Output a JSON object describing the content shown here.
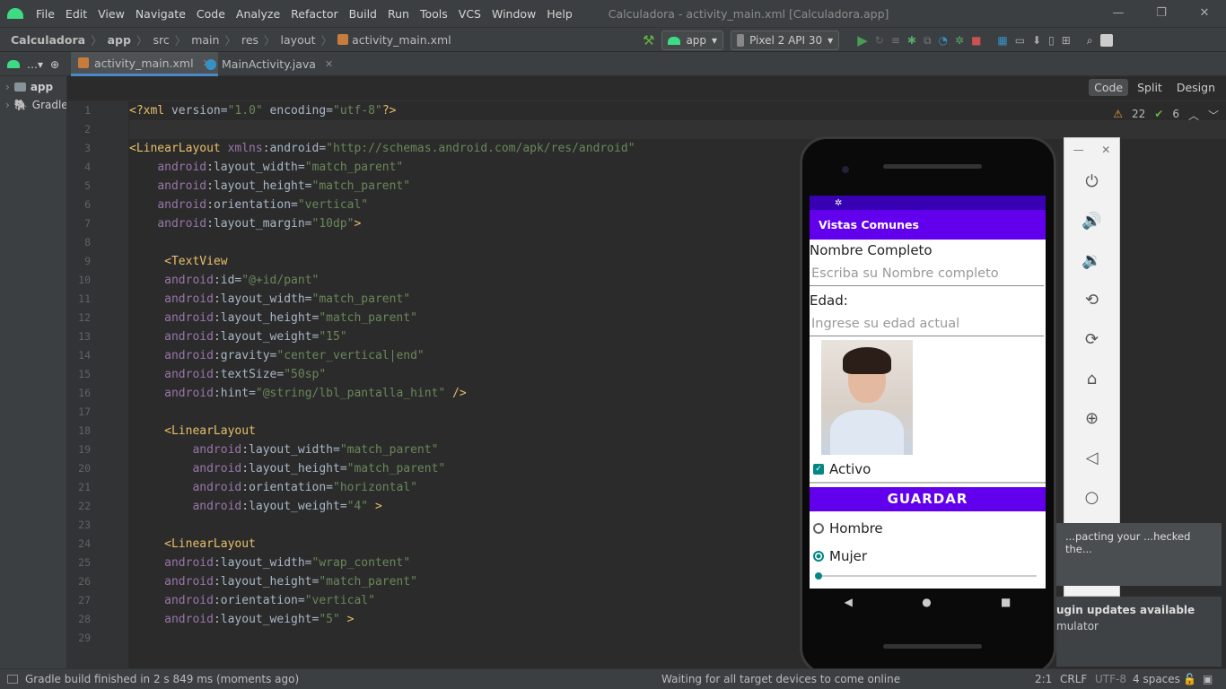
{
  "menu": [
    "File",
    "Edit",
    "View",
    "Navigate",
    "Code",
    "Analyze",
    "Refactor",
    "Build",
    "Run",
    "Tools",
    "VCS",
    "Window",
    "Help"
  ],
  "window_title": "Calculadora - activity_main.xml [Calculadora.app]",
  "breadcrumbs": [
    "Calculadora",
    "app",
    "src",
    "main",
    "res",
    "layout",
    "activity_main.xml"
  ],
  "toolbar": {
    "config": "app",
    "device": "Pixel 2 API 30"
  },
  "tabs": [
    {
      "label": "activity_main.xml"
    },
    {
      "label": "MainActivity.java"
    }
  ],
  "project": {
    "items": [
      {
        "label": "app"
      },
      {
        "label": "Gradle"
      }
    ]
  },
  "editor_modes": [
    "Code",
    "Split",
    "Design"
  ],
  "inspections": {
    "warnings": "22",
    "ok": "6"
  },
  "code_lines": [
    "<?xml version=\"1.0\" encoding=\"utf-8\"?>",
    "",
    "<LinearLayout xmlns:android=\"http://schemas.android.com/apk/res/android\"",
    "    android:layout_width=\"match_parent\"",
    "    android:layout_height=\"match_parent\"",
    "    android:orientation=\"vertical\"",
    "    android:layout_margin=\"10dp\">",
    "",
    "     <TextView",
    "     android:id=\"@+id/pant\"",
    "     android:layout_width=\"match_parent\"",
    "     android:layout_height=\"match_parent\"",
    "     android:layout_weight=\"15\"",
    "     android:gravity=\"center_vertical|end\"",
    "     android:textSize=\"50sp\"",
    "     android:hint=\"@string/lbl_pantalla_hint\" />",
    "",
    "     <LinearLayout",
    "         android:layout_width=\"match_parent\"",
    "         android:layout_height=\"match_parent\"",
    "         android:orientation=\"horizontal\"",
    "         android:layout_weight=\"4\" >",
    "",
    "     <LinearLayout",
    "     android:layout_width=\"wrap_content\"",
    "     android:layout_height=\"match_parent\"",
    "     android:orientation=\"vertical\"",
    "     android:layout_weight=\"5\" >",
    ""
  ],
  "emulator": {
    "app_bar_title": "Vistas Comunes",
    "label_name": "Nombre Completo",
    "hint_name": "Escriba su Nombre completo",
    "label_age": "Edad:",
    "hint_age": "Ingrese su edad actual",
    "checkbox_label": "Activo",
    "button_label": "GUARDAR",
    "radio_male": "Hombre",
    "radio_female": "Mujer"
  },
  "notifications": {
    "n1": "...pacting your ...hecked the...",
    "n2_title": "ugin updates available",
    "n2_sub": "mulator"
  },
  "status": {
    "left": "Gradle build finished in 2 s 849 ms (moments ago)",
    "middle": "Waiting for all target devices to come online",
    "pos": "2:1",
    "eol": "CRLF",
    "enc": "UTF-8",
    "indent": "4 spaces"
  },
  "colors": {
    "accent": "#6200ee",
    "status_bar": "#3700b3",
    "teal": "#018786"
  }
}
